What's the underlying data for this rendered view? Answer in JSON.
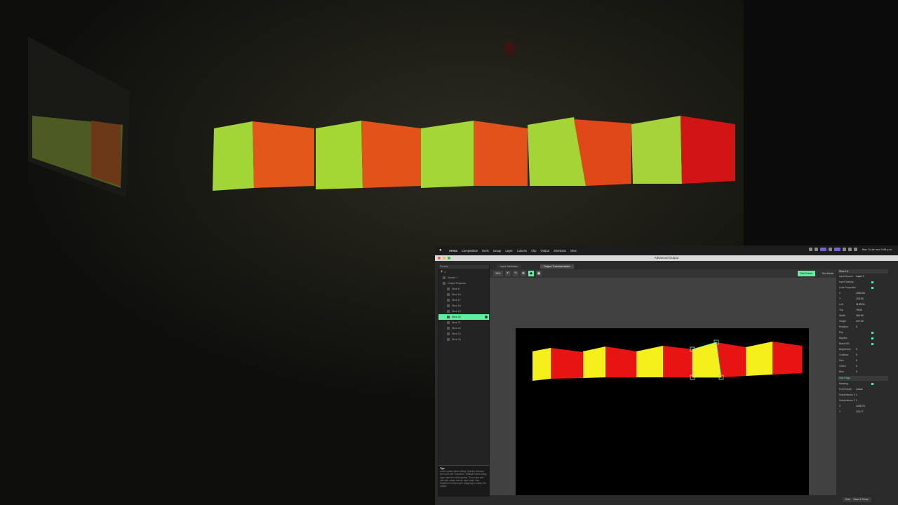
{
  "menubar": {
    "items": [
      "Arena",
      "Composition",
      "Deck",
      "Group",
      "Layer",
      "Column",
      "Clip",
      "Output",
      "Shortcuts",
      "View"
    ],
    "clock": "Mar 11 de nov 9:48 p.m."
  },
  "window": {
    "title": "Advanced Output"
  },
  "left_panel": {
    "header": "Presets",
    "screen_label": "Screen 1",
    "projector_label": "Output Projector",
    "slices": [
      "Slice 8",
      "Slice 16",
      "Slice 17",
      "Slice 18",
      "Slice 19",
      "Slice 20",
      "Slice 21",
      "Slice 22",
      "Slice 23",
      "Slice 24"
    ],
    "selected_index": 5,
    "tip_title": "Tips",
    "tip_text": "Lorem ipsum slice editing. Quickly reshape the input with Transform. Multiple slices using input select to edit together. Zoom and pan edit with output screen input map. Use transform to draw your mapping to match the output."
  },
  "tabs": {
    "input": "Input Selection",
    "output": "Output Transformation"
  },
  "toolbar": {
    "zoom": "50%",
    "edit_points": "Edit Points",
    "test_mode": "Test Mode",
    "layer_label": "Layer 1"
  },
  "right_panel": {
    "title": "Slice 16",
    "rows": [
      {
        "label": "Input Source",
        "value": "Layer 2"
      },
      {
        "label": "Input Opacity",
        "value": ""
      },
      {
        "label": "Lock Proportions",
        "value": ""
      },
      {
        "label": "X",
        "value": "1280.00"
      },
      {
        "label": "Y",
        "value": "120.00"
      },
      {
        "label": "Left",
        "value": "1135.00"
      },
      {
        "label": "Top",
        "value": "75.00"
      },
      {
        "label": "Width",
        "value": "160.00"
      },
      {
        "label": "Height",
        "value": "247.00"
      },
      {
        "label": "Rotation",
        "value": "0"
      },
      {
        "label": "Flip",
        "value": ""
      },
      {
        "label": "Bypass",
        "value": ""
      },
      {
        "label": "Black BG",
        "value": ""
      },
      {
        "label": "Brightness",
        "value": "0"
      },
      {
        "label": "Contrast",
        "value": "0"
      },
      {
        "label": "Red",
        "value": "0"
      },
      {
        "label": "Green",
        "value": "0"
      },
      {
        "label": "Blue",
        "value": "0"
      }
    ],
    "section2": "Soft Edge",
    "rows2": [
      {
        "label": "Masking",
        "value": ""
      },
      {
        "label": "Point Mode",
        "value": "Linear"
      },
      {
        "label": "Subdivisions X",
        "value": "1"
      },
      {
        "label": "Subdivisions Y",
        "value": "1"
      },
      {
        "label": "X",
        "value": "1235.75"
      },
      {
        "label": "Y",
        "value": "123.77"
      }
    ]
  },
  "bottom": {
    "close_label": "Close",
    "save_label": "Save & Close"
  },
  "colors": {
    "accent": "#5ef0a0",
    "face_yellow": "#f5f01c",
    "face_red": "#e81414",
    "proj_green": "#a4d535",
    "proj_orange": "#e4541c"
  }
}
